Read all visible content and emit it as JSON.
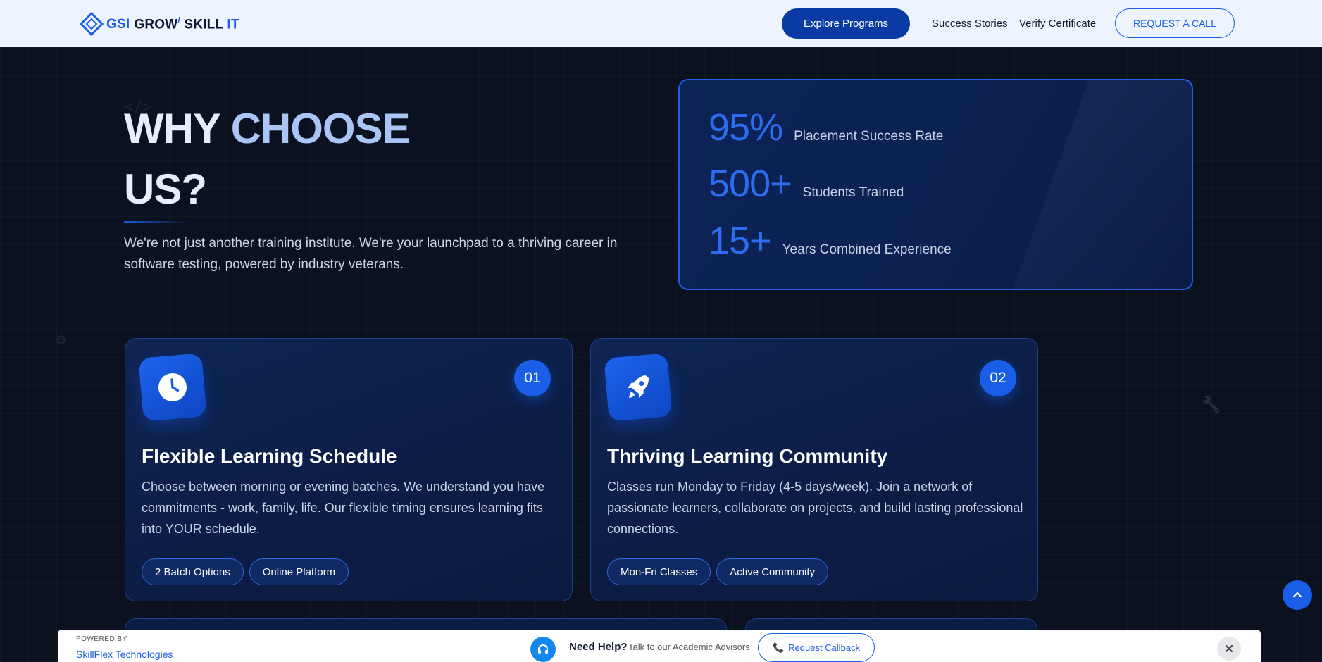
{
  "nav": {
    "logo": {
      "prefix": "GSI",
      "brand": "GROW",
      "brand_tail": "SKILL",
      "brand_it": "IT"
    },
    "explore_label": "Explore Programs",
    "links": [
      "Success Stories",
      "Verify Certificate"
    ],
    "request_call_label": "REQUEST A CALL"
  },
  "hero": {
    "title_line1_a": "WHY ",
    "title_line1_b": "CHOOSE",
    "title_line2": "US?",
    "description": "We're not just another training institute. We're your launchpad to a thriving career in software testing, powered by industry veterans."
  },
  "stats": [
    {
      "value": "95%",
      "label": "Placement Success Rate"
    },
    {
      "value": "500+",
      "label": "Students Trained"
    },
    {
      "value": "15+",
      "label": "Years Combined Experience"
    }
  ],
  "cards": [
    {
      "number": "01",
      "icon": "clock-icon",
      "title": "Flexible Learning Schedule",
      "description": "Choose between morning or evening batches. We understand you have commitments - work, family, life. Our flexible timing ensures learning fits into YOUR schedule.",
      "tags": [
        "2 Batch Options",
        "Online Platform"
      ]
    },
    {
      "number": "02",
      "icon": "rocket-icon",
      "title": "Thriving Learning Community",
      "description": "Classes run Monday to Friday (4-5 days/week). Join a network of passionate learners, collaborate on projects, and build lasting professional connections.",
      "tags": [
        "Mon-Fri Classes",
        "Active Community"
      ]
    }
  ],
  "helpbar": {
    "powered_label": "POWERED BY",
    "powered_name": "SkillFlex Technologies",
    "help_title": "Need Help?",
    "help_sub": "Talk to our Academic Advisors",
    "callback_label": "Request Callback"
  },
  "colors": {
    "accent": "#1a5ee8",
    "navy": "#0a3aa3",
    "background": "#0c1120"
  }
}
